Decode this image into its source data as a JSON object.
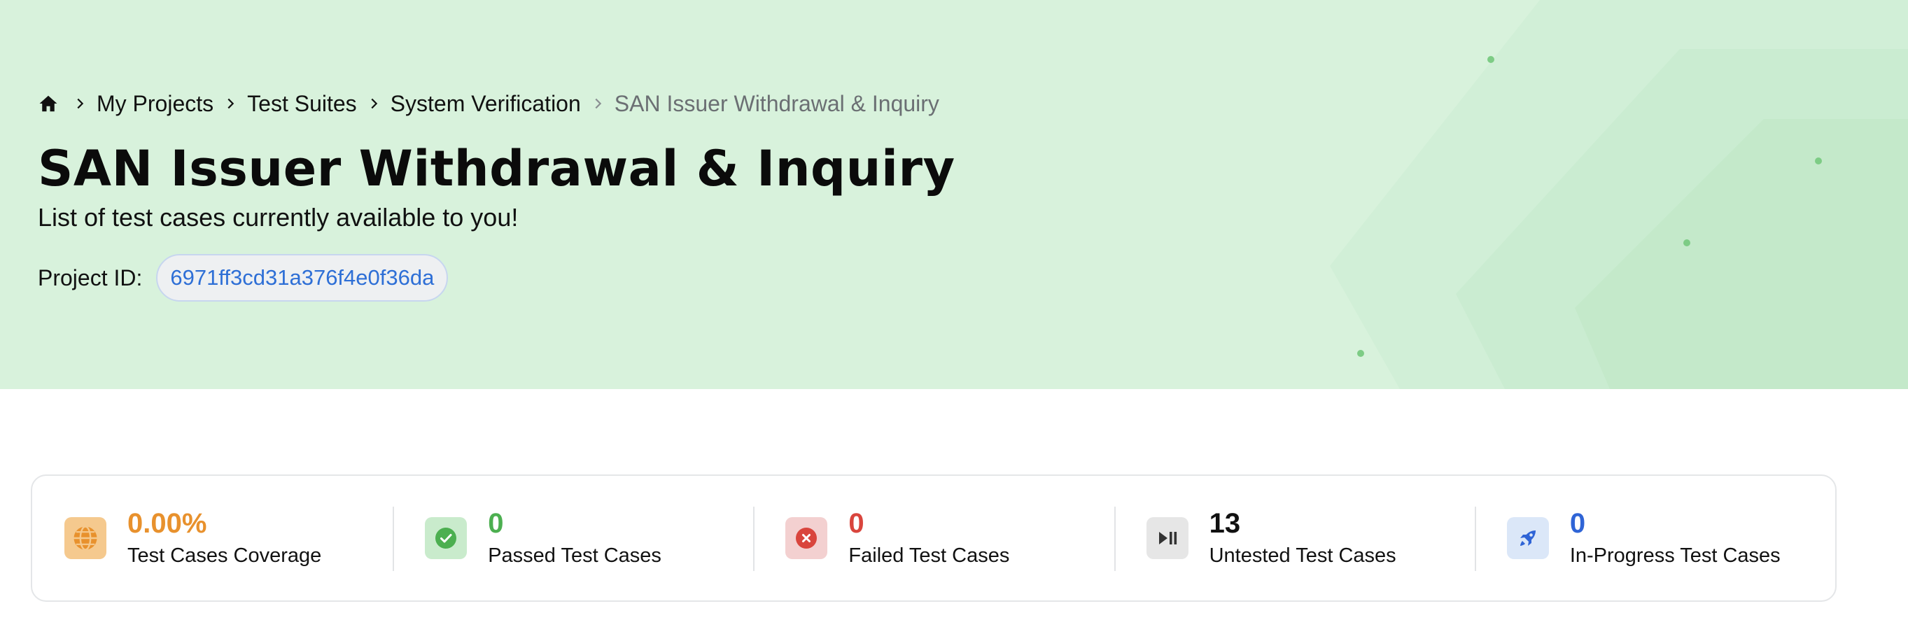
{
  "breadcrumb": {
    "home_icon": "home-icon",
    "items": [
      "My Projects",
      "Test Suites",
      "System Verification"
    ],
    "current": "SAN Issuer Withdrawal & Inquiry"
  },
  "header": {
    "title": "SAN Issuer Withdrawal & Inquiry",
    "subtitle": "List of test cases currently available to you!",
    "project_label": "Project ID:",
    "project_id": "6971ff3cd31a376f4e0f36da"
  },
  "stats": [
    {
      "value": "0.00%",
      "label": "Test Cases Coverage",
      "icon": "globe-icon",
      "color": "#e8912d",
      "bg": "#f5c98e"
    },
    {
      "value": "0",
      "label": "Passed Test Cases",
      "icon": "check-circle-icon",
      "color": "#4caf50",
      "bg": "#c9ebcc"
    },
    {
      "value": "0",
      "label": "Failed Test Cases",
      "icon": "x-circle-icon",
      "color": "#d9453d",
      "bg": "#f3d0d0"
    },
    {
      "value": "13",
      "label": "Untested Test Cases",
      "icon": "play-pause-icon",
      "color": "#111111",
      "bg": "#e6e6e6"
    },
    {
      "value": "0",
      "label": "In-Progress Test Cases",
      "icon": "rocket-icon",
      "color": "#2f64d6",
      "bg": "#dbe7f8"
    }
  ],
  "colors": {
    "hero_bg": "#d8f2dc",
    "link": "#2e6fd6"
  }
}
